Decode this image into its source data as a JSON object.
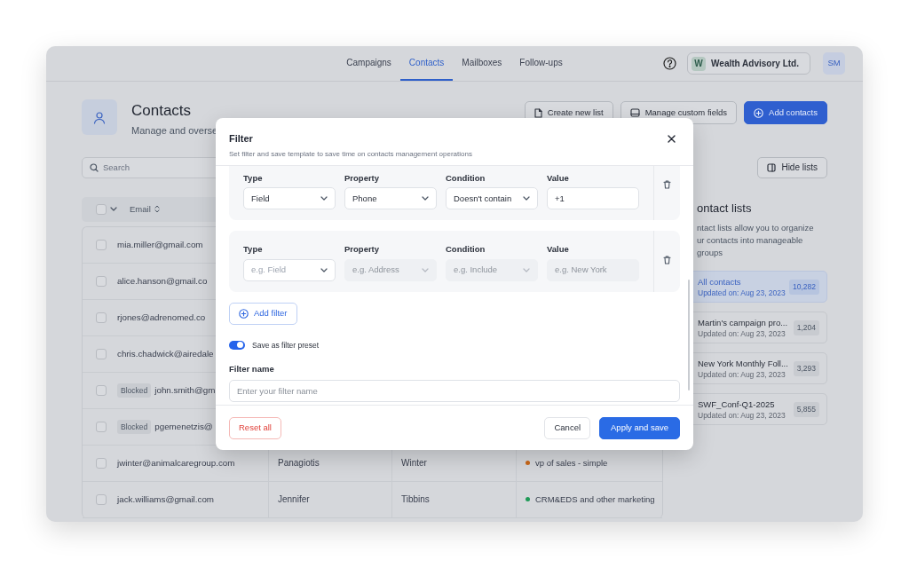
{
  "nav": {
    "tabs": [
      {
        "label": "Campaigns",
        "selected": false
      },
      {
        "label": "Contacts",
        "selected": true
      },
      {
        "label": "Mailboxes",
        "selected": false
      },
      {
        "label": "Follow-ups",
        "selected": false
      }
    ],
    "org": {
      "initial": "W",
      "name": "Wealth Advisory Ltd."
    },
    "avatar": "SM"
  },
  "header": {
    "title": "Contacts",
    "subtitle": "Manage and overse",
    "buttons": [
      {
        "label": "Create new list",
        "kind": "outline"
      },
      {
        "label": "Manage custom fields",
        "kind": "outline"
      },
      {
        "label": "Add contacts",
        "kind": "primary"
      }
    ]
  },
  "search": {
    "placeholder": "Search"
  },
  "hide_lists_button": "Hide lists",
  "table": {
    "all_checked": false,
    "columns": [
      {
        "label": "Email"
      }
    ],
    "rows": [
      {
        "checked": false,
        "email": "mia.miller@gmail.com"
      },
      {
        "checked": false,
        "email": "alice.hanson@gmail.co"
      },
      {
        "checked": false,
        "email": "rjones@adrenomed.co"
      },
      {
        "checked": false,
        "email": "chris.chadwick@airedale"
      },
      {
        "checked": false,
        "tag": "Blocked",
        "email": "john.smith@gm"
      },
      {
        "checked": false,
        "tag": "Blocked",
        "email": "pgemenetzis@"
      },
      {
        "checked": false,
        "email": "jwinter@animalcaregroup.com",
        "first_name": "Panagiotis",
        "last_name": "Winter",
        "list": {
          "name": "vp of sales - simple",
          "color": "#c8671a"
        }
      },
      {
        "checked": false,
        "email": "jack.williams@gmail.com",
        "first_name": "Jennifer",
        "last_name": "Tibbins",
        "list": {
          "name": "CRM&EDS and other marketing",
          "color": "#1f9a57"
        }
      }
    ]
  },
  "contact_lists": {
    "title": "ontact lists",
    "description": [
      "ntact lists allow you to organize",
      "ur contacts into manageable groups"
    ],
    "items": [
      {
        "name": "All contacts",
        "updated": "Updated on: Aug 23, 2023",
        "count": "10,282",
        "selected": true
      },
      {
        "name": "Martin's campaign pro...",
        "updated": "Updated on: Aug 23, 2023",
        "count": "1,204",
        "selected": false
      },
      {
        "name": "New York Monthly Foll...",
        "updated": "Updated on: Aug 23, 2023",
        "count": "3,293",
        "selected": false
      },
      {
        "name": "SWF_Conf-Q1-2025",
        "updated": "Updated on: Aug 23, 2023",
        "count": "5,855",
        "selected": false
      }
    ]
  },
  "modal": {
    "title": "Filter",
    "subtitle": "Set filter and save template to save time on contacts management operations",
    "filters": [
      {
        "fields": [
          {
            "label": "Type",
            "kind": "select",
            "value": "Field",
            "disabled": false
          },
          {
            "label": "Property",
            "kind": "select",
            "value": "Phone",
            "disabled": false
          },
          {
            "label": "Condition",
            "kind": "select",
            "value": "Doesn't contain",
            "disabled": false
          },
          {
            "label": "Value",
            "kind": "input",
            "value": "+1",
            "disabled": false
          }
        ]
      },
      {
        "fields": [
          {
            "label": "Type",
            "kind": "select",
            "placeholder": "e.g. Field",
            "disabled": false
          },
          {
            "label": "Property",
            "kind": "select",
            "placeholder": "e.g. Address",
            "disabled": true
          },
          {
            "label": "Condition",
            "kind": "select",
            "placeholder": "e.g. Include",
            "disabled": true
          },
          {
            "label": "Value",
            "kind": "input",
            "placeholder": "e.g. New York",
            "disabled": true
          }
        ]
      }
    ],
    "add_filter": "Add filter",
    "preset_toggle": {
      "label": "Save as filter preset",
      "on": true
    },
    "filter_name": {
      "label": "Filter name",
      "placeholder": "Enter your filter name"
    },
    "buttons": [
      {
        "label": "Reset all",
        "kind": "danger"
      },
      {
        "label": "Cancel",
        "kind": "outline"
      },
      {
        "label": "Apply and save",
        "kind": "primary"
      }
    ]
  }
}
